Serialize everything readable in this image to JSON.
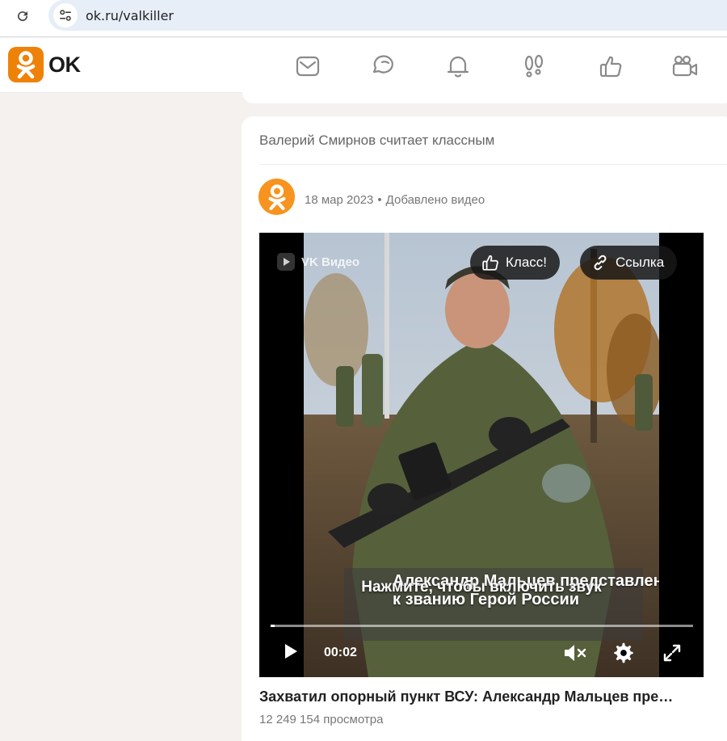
{
  "browser": {
    "url": "ok.ru/valkiller",
    "reload_icon": "reload-icon",
    "site_info_icon": "tune-icon"
  },
  "header": {
    "logo_text": "OK",
    "brand_color": "#ee8208",
    "nav_icons": [
      "mail-icon",
      "chat-icon",
      "bell-icon",
      "footprints-icon",
      "thumbs-up-icon",
      "video-camera-icon"
    ]
  },
  "post": {
    "liked_by": "Валерий Смирнов считает классным",
    "date": "18 мар 2023",
    "separator": "•",
    "action": "Добавлено видео",
    "video": {
      "source_label": "VK Видео",
      "like_label": "Класс!",
      "link_label": "Ссылка",
      "caption": "Александр Мальцев представлен к званию Герой России",
      "sound_hint": "Нажмите, чтобы включить звук",
      "time": "00:02",
      "progress": 0.01
    },
    "title": "Захватил опорный пункт ВСУ: Александр Мальцев пре…",
    "views": "12 249 154 просмотра"
  }
}
